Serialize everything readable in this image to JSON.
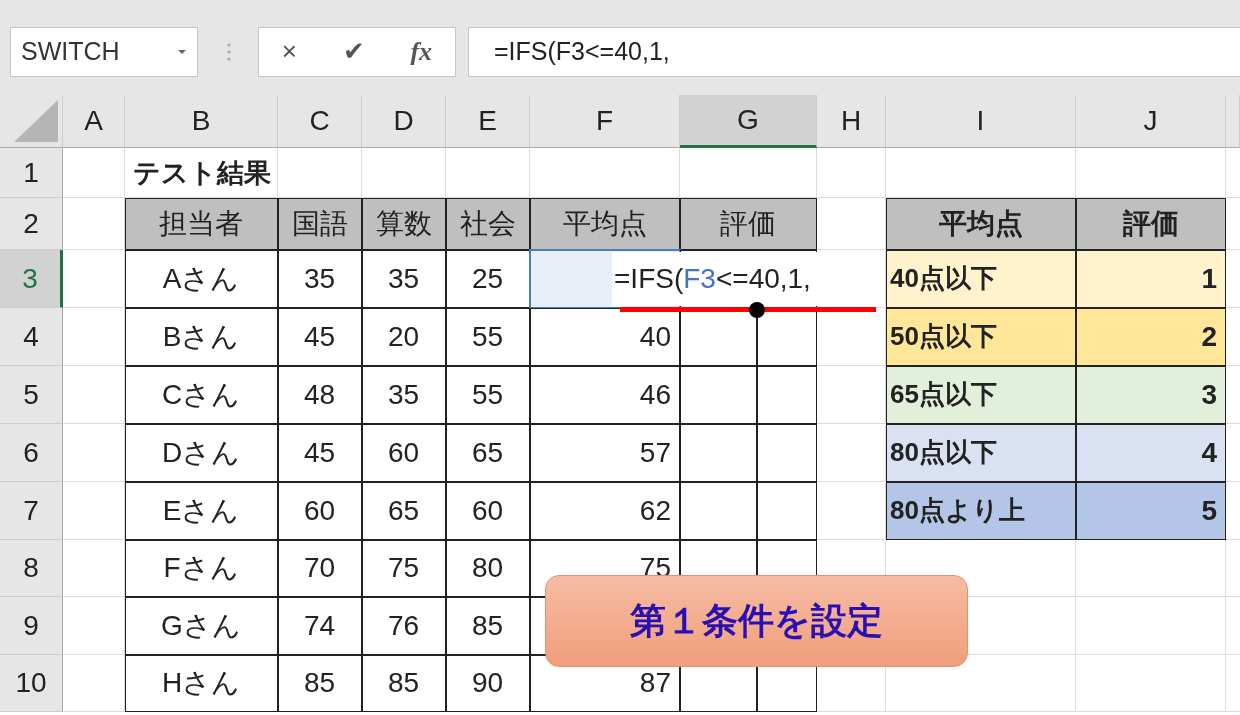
{
  "name_box": {
    "value": "SWITCH"
  },
  "formula_buttons": [
    "×",
    "✔",
    "fx"
  ],
  "formula_bar": {
    "value": "=IFS(F3<=40,1,"
  },
  "columns": [
    {
      "label": "A",
      "selected": false
    },
    {
      "label": "B",
      "selected": false
    },
    {
      "label": "C",
      "selected": false
    },
    {
      "label": "D",
      "selected": false
    },
    {
      "label": "E",
      "selected": false
    },
    {
      "label": "F",
      "selected": false
    },
    {
      "label": "G",
      "selected": true
    },
    {
      "label": "H",
      "selected": false
    },
    {
      "label": "I",
      "selected": false
    },
    {
      "label": "J",
      "selected": false
    }
  ],
  "rows": [
    {
      "label": "1",
      "selected": false,
      "cells": [
        {
          "kind": "empty"
        },
        {
          "kind": "title",
          "text": "テスト結果"
        },
        {
          "kind": "empty"
        },
        {
          "kind": "empty"
        },
        {
          "kind": "empty"
        },
        {
          "kind": "empty"
        },
        {
          "kind": "empty"
        },
        {
          "kind": "empty"
        },
        {
          "kind": "empty"
        },
        {
          "kind": "empty"
        }
      ]
    },
    {
      "label": "2",
      "selected": false,
      "cells": [
        {
          "kind": "empty"
        },
        {
          "kind": "head",
          "text": "担当者"
        },
        {
          "kind": "head",
          "text": "国語"
        },
        {
          "kind": "head",
          "text": "算数"
        },
        {
          "kind": "head",
          "text": "社会"
        },
        {
          "kind": "head",
          "text": "平均点"
        },
        {
          "kind": "head",
          "text": "評価"
        },
        {
          "kind": "empty"
        },
        {
          "kind": "head-bold",
          "text": "平均点"
        },
        {
          "kind": "head-bold",
          "text": "評価"
        }
      ]
    },
    {
      "label": "3",
      "selected": true,
      "cells": [
        {
          "kind": "empty"
        },
        {
          "kind": "center",
          "text": "Aさん"
        },
        {
          "kind": "center",
          "text": "35"
        },
        {
          "kind": "center",
          "text": "35"
        },
        {
          "kind": "center",
          "text": "25"
        },
        {
          "kind": "active"
        },
        {
          "kind": "box"
        },
        {
          "kind": "empty"
        },
        {
          "kind": "band",
          "text": "40点以下",
          "color": "#fff2cc"
        },
        {
          "kind": "band-num",
          "text": "1",
          "color": "#fff2cc"
        }
      ]
    },
    {
      "label": "4",
      "selected": false,
      "cells": [
        {
          "kind": "empty"
        },
        {
          "kind": "center",
          "text": "Bさん"
        },
        {
          "kind": "center",
          "text": "45"
        },
        {
          "kind": "center",
          "text": "20"
        },
        {
          "kind": "center",
          "text": "55"
        },
        {
          "kind": "num",
          "text": "40"
        },
        {
          "kind": "box"
        },
        {
          "kind": "empty"
        },
        {
          "kind": "band",
          "text": "50点以下",
          "color": "#ffe699"
        },
        {
          "kind": "band-num",
          "text": "2",
          "color": "#ffe699"
        }
      ]
    },
    {
      "label": "5",
      "selected": false,
      "cells": [
        {
          "kind": "empty"
        },
        {
          "kind": "center",
          "text": "Cさん"
        },
        {
          "kind": "center",
          "text": "48"
        },
        {
          "kind": "center",
          "text": "35"
        },
        {
          "kind": "center",
          "text": "55"
        },
        {
          "kind": "num",
          "text": "46"
        },
        {
          "kind": "box"
        },
        {
          "kind": "empty"
        },
        {
          "kind": "band",
          "text": "65点以下",
          "color": "#e2efda"
        },
        {
          "kind": "band-num",
          "text": "3",
          "color": "#e2efda"
        }
      ]
    },
    {
      "label": "6",
      "selected": false,
      "cells": [
        {
          "kind": "empty"
        },
        {
          "kind": "center",
          "text": "Dさん"
        },
        {
          "kind": "center",
          "text": "45"
        },
        {
          "kind": "center",
          "text": "60"
        },
        {
          "kind": "center",
          "text": "65"
        },
        {
          "kind": "num",
          "text": "57"
        },
        {
          "kind": "box"
        },
        {
          "kind": "empty"
        },
        {
          "kind": "band",
          "text": "80点以下",
          "color": "#d9e1f2"
        },
        {
          "kind": "band-num",
          "text": "4",
          "color": "#d9e1f2"
        }
      ]
    },
    {
      "label": "7",
      "selected": false,
      "cells": [
        {
          "kind": "empty"
        },
        {
          "kind": "center",
          "text": "Eさん"
        },
        {
          "kind": "center",
          "text": "60"
        },
        {
          "kind": "center",
          "text": "65"
        },
        {
          "kind": "center",
          "text": "60"
        },
        {
          "kind": "num",
          "text": "62"
        },
        {
          "kind": "box"
        },
        {
          "kind": "empty"
        },
        {
          "kind": "band",
          "text": "80点より上",
          "color": "#b4c6e7"
        },
        {
          "kind": "band-num",
          "text": "5",
          "color": "#b4c6e7"
        }
      ]
    },
    {
      "label": "8",
      "selected": false,
      "cells": [
        {
          "kind": "empty"
        },
        {
          "kind": "center",
          "text": "Fさん"
        },
        {
          "kind": "center",
          "text": "70"
        },
        {
          "kind": "center",
          "text": "75"
        },
        {
          "kind": "center",
          "text": "80"
        },
        {
          "kind": "num",
          "text": "75"
        },
        {
          "kind": "box"
        },
        {
          "kind": "empty"
        },
        {
          "kind": "empty"
        },
        {
          "kind": "empty"
        }
      ]
    },
    {
      "label": "9",
      "selected": false,
      "cells": [
        {
          "kind": "empty"
        },
        {
          "kind": "center",
          "text": "Gさん"
        },
        {
          "kind": "center",
          "text": "74"
        },
        {
          "kind": "center",
          "text": "76"
        },
        {
          "kind": "center",
          "text": "85"
        },
        {
          "kind": "box"
        },
        {
          "kind": "box"
        },
        {
          "kind": "empty"
        },
        {
          "kind": "empty"
        },
        {
          "kind": "empty"
        }
      ]
    },
    {
      "label": "10",
      "selected": false,
      "cells": [
        {
          "kind": "empty"
        },
        {
          "kind": "center",
          "text": "Hさん"
        },
        {
          "kind": "center",
          "text": "85"
        },
        {
          "kind": "center",
          "text": "85"
        },
        {
          "kind": "center",
          "text": "90"
        },
        {
          "kind": "num",
          "text": "87"
        },
        {
          "kind": "box"
        },
        {
          "kind": "empty"
        },
        {
          "kind": "empty"
        },
        {
          "kind": "empty"
        }
      ]
    }
  ],
  "in_cell_edit": {
    "parts": [
      {
        "kind": "plain",
        "text": "=IFS("
      },
      {
        "kind": "ref",
        "text": "F3"
      },
      {
        "kind": "plain",
        "text": "<=40,1,"
      }
    ]
  },
  "callout": {
    "text": "第１条件を設定"
  }
}
